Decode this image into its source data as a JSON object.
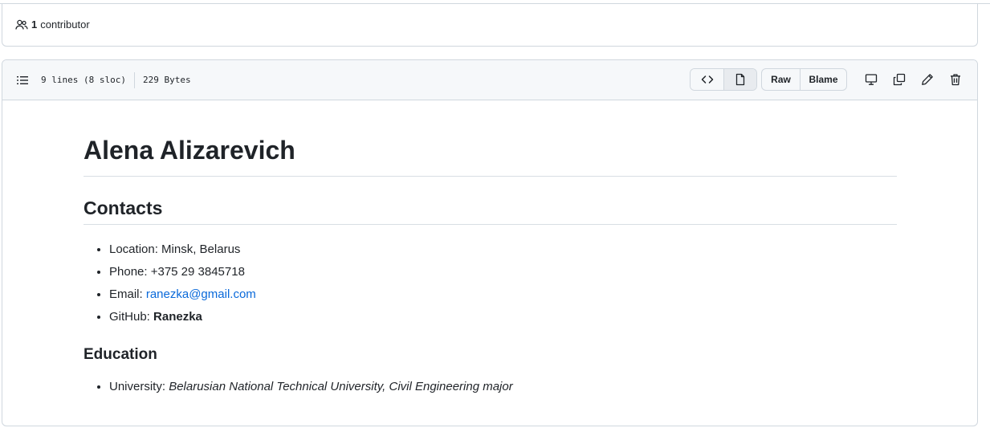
{
  "contributors": {
    "count": "1",
    "label": "contributor",
    "icon": "people-icon"
  },
  "file_header": {
    "lines": "9 lines (8 sloc)",
    "size": "229 Bytes",
    "buttons": {
      "code_view_icon": "code-icon",
      "preview_icon": "file-icon",
      "raw": "Raw",
      "blame": "Blame",
      "display_icon": "desktop-icon",
      "copy_icon": "copy-icon",
      "edit_icon": "pencil-icon",
      "delete_icon": "trash-icon"
    }
  },
  "readme": {
    "title": "Alena Alizarevich",
    "contacts_heading": "Contacts",
    "contacts": [
      {
        "label": "Location: ",
        "value": "Minsk, Belarus"
      },
      {
        "label": "Phone: ",
        "value": "+375 29 3845718"
      },
      {
        "label": "Email: ",
        "value": "ranezka@gmail.com"
      },
      {
        "label": "GitHub: ",
        "value": "Ranezka"
      }
    ],
    "education_heading": "Education",
    "education": [
      {
        "label": "University: ",
        "value": "Belarusian National Technical University, Civil Engineering major"
      }
    ]
  },
  "colors": {
    "link": "#0969da",
    "border": "#d0d7de",
    "header_bg": "#f6f8fa",
    "text": "#1f2328"
  }
}
